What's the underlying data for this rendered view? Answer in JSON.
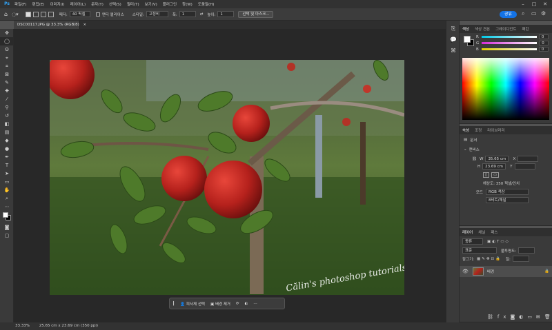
{
  "menubar": {
    "logo": "Ps",
    "items": [
      "파일(F)",
      "편집(E)",
      "이미지(I)",
      "레이어(L)",
      "문자(Y)",
      "선택(S)",
      "필터(T)",
      "보기(V)",
      "플러그인",
      "창(W)",
      "도움말(H)"
    ]
  },
  "options": {
    "feather_label": "페더:",
    "feather_value": "40 픽셀",
    "antialias_label": "앤티 앨리어스",
    "style_label": "스타일:",
    "style_value": "고정비",
    "width_label": "폭:",
    "width_value": "1",
    "height_label": "높이:",
    "height_value": "1",
    "select_mask_button": "선택 및 마스크...",
    "share_button": "공유"
  },
  "document": {
    "tab_label": "DSC00117.JPG @ 33.3% (RGB/8)",
    "watermark": "Călin's photoshop tutorials"
  },
  "context_bar": {
    "select_subject": "피사체 선택",
    "remove_background": "배경 제거"
  },
  "status": {
    "zoom": "33.33%",
    "doc_info": "25.65 cm x 23.69 cm (350 ppi)"
  },
  "color_panel": {
    "tabs": [
      "색상",
      "색상 견본",
      "그레이디언트",
      "패턴"
    ],
    "channels": [
      {
        "label": "R",
        "value": "0",
        "gradient": "#00c8e6"
      },
      {
        "label": "G",
        "value": "0",
        "gradient": "#d52ad8"
      },
      {
        "label": "B",
        "value": "0",
        "gradient": "#e0d000"
      }
    ]
  },
  "properties_panel": {
    "tabs": [
      "속성",
      "조정",
      "라이브러리"
    ],
    "doc_label": "문서",
    "canvas_section": "캔버스",
    "w_label": "W",
    "w_value": "35.65 cm",
    "x_label": "X",
    "h_label": "H",
    "h_value": "23.69 cm",
    "y_label": "Y",
    "resolution": "해상도: 350 픽셀/인치",
    "mode_label": "모드",
    "mode_value": "RGB 색상",
    "bit_depth": "8비트/채널"
  },
  "layers_panel": {
    "tabs": [
      "레이어",
      "채널",
      "패스"
    ],
    "kind_label": "종류",
    "blend_mode": "표준",
    "opacity_label": "불투명도:",
    "lock_label": "잠그기:",
    "fill_label": "칠:",
    "layer_name": "배경"
  },
  "colors": {
    "accent": "#1473e6",
    "canvas_bg": "#282828",
    "panel_bg": "#3a3a3a"
  }
}
